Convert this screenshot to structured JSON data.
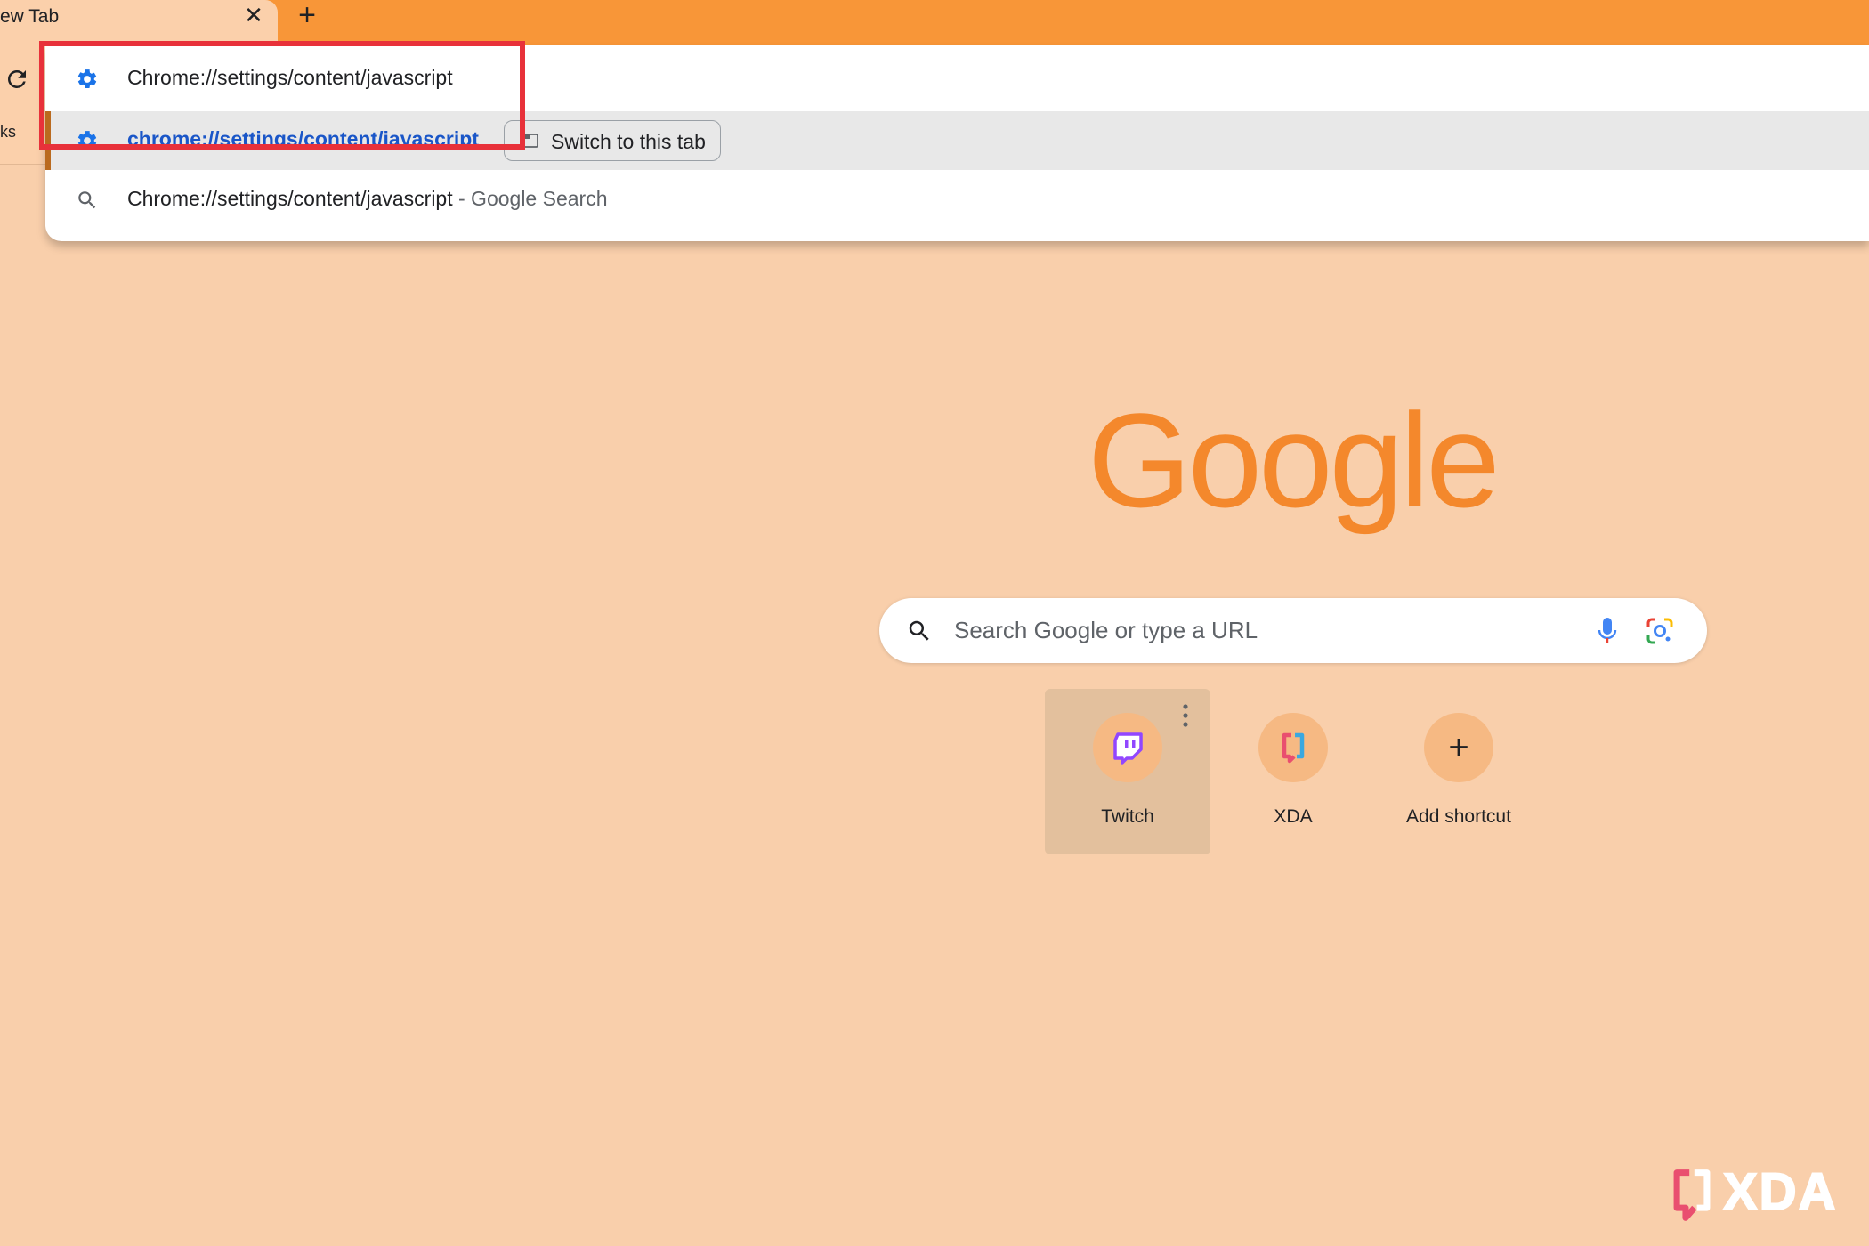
{
  "browser": {
    "tab": {
      "title": "ew Tab",
      "close_glyph": "✕"
    },
    "new_tab_glyph": "+",
    "bookmarks_fragment": "ks"
  },
  "omnibox": {
    "input_value": "Chrome://settings/content/javascript",
    "suggestions": [
      {
        "icon": "gear-icon",
        "text": "chrome://settings/content/javascript",
        "action_label": "Switch to this tab",
        "selected": true
      },
      {
        "icon": "search-icon",
        "text": "Chrome://settings/content/javascript",
        "suffix": " - Google Search"
      }
    ]
  },
  "ntp": {
    "logo_text": "Google",
    "search_placeholder": "Search Google or type a URL",
    "shortcuts": [
      {
        "label": "Twitch",
        "icon": "twitch-icon"
      },
      {
        "label": "XDA",
        "icon": "xda-icon"
      },
      {
        "label": "Add shortcut",
        "icon": "plus-icon"
      }
    ]
  },
  "watermark": {
    "text": "XDA"
  },
  "colors": {
    "tabstrip": "#f89638",
    "page_background": "#f9cfab",
    "logo": "#f4882c",
    "highlight_box": "#e8313a",
    "link_blue": "#1a56c8"
  }
}
